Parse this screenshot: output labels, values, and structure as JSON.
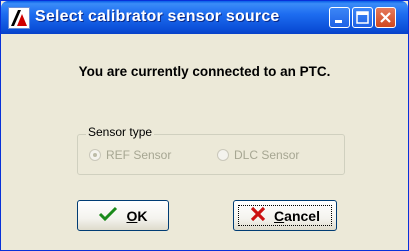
{
  "window": {
    "title": "Select calibrator sensor source",
    "controls": {
      "minimize": "minimize",
      "maximize": "maximize",
      "close": "close"
    }
  },
  "message": "You are currently connected to an PTC.",
  "sensor_group": {
    "legend": "Sensor type",
    "options": [
      {
        "label": "REF Sensor",
        "selected": true,
        "enabled": false
      },
      {
        "label": "DLC Sensor",
        "selected": false,
        "enabled": false
      }
    ]
  },
  "buttons": {
    "ok": {
      "mnemonic": "O",
      "rest": "K",
      "icon": "checkmark-icon",
      "icon_color": "#1a8a1a"
    },
    "cancel": {
      "mnemonic": "C",
      "rest": "ancel",
      "icon": "x-icon",
      "icon_color": "#cc1010",
      "focused": true
    }
  },
  "colors": {
    "titlebar": "#0b4fd8",
    "dialog_bg": "#ece9d8",
    "disabled_text": "#a6a692"
  }
}
